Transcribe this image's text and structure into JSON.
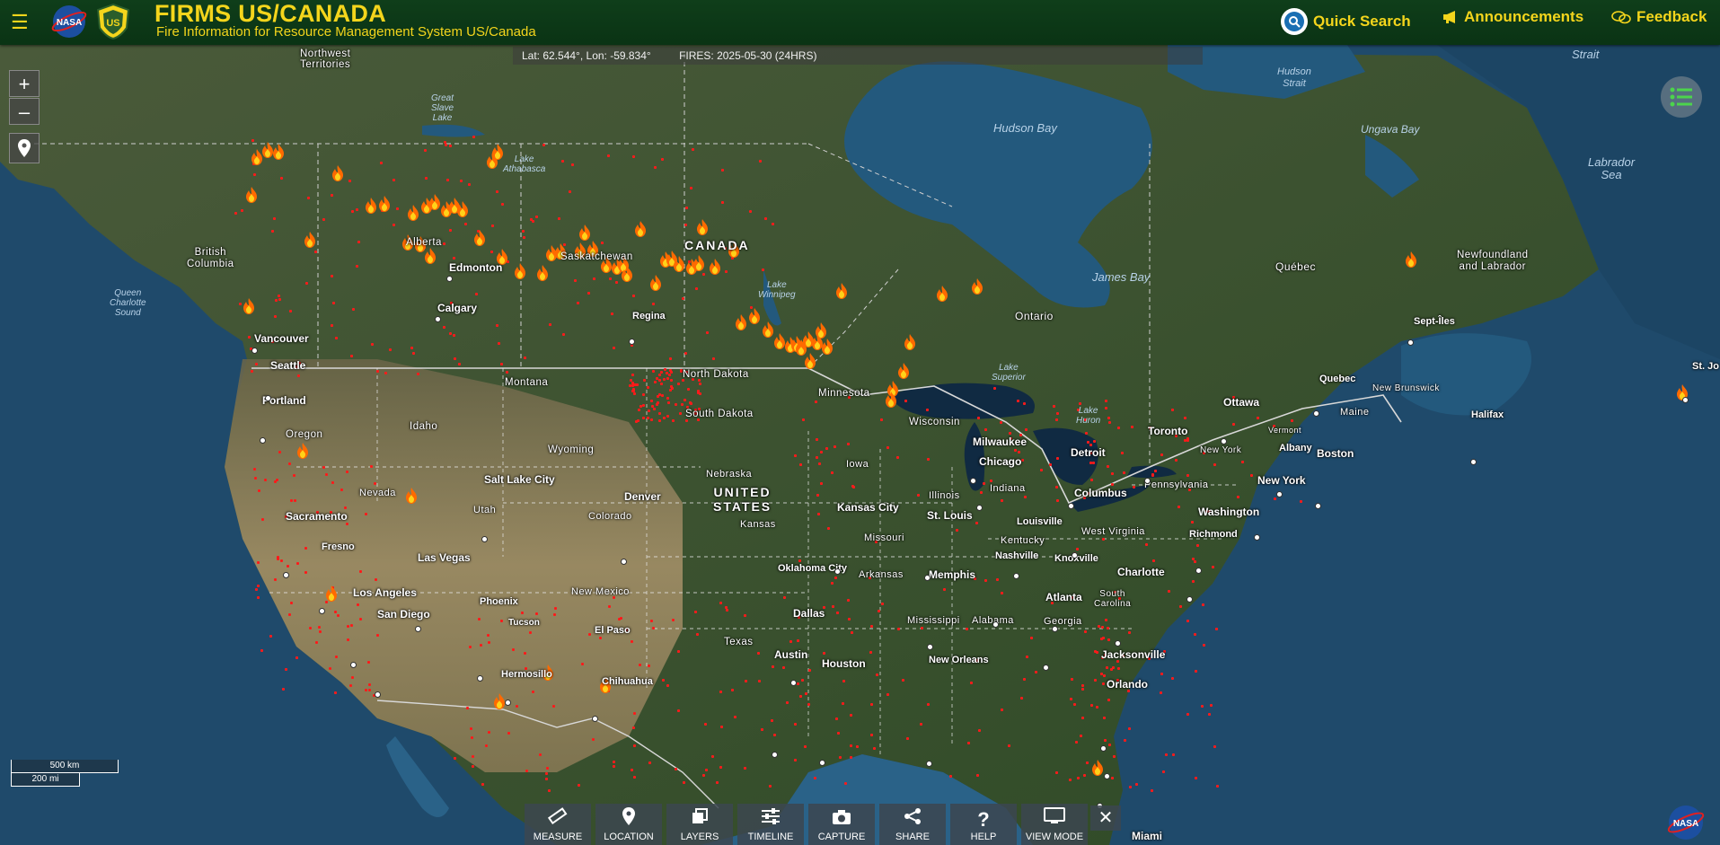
{
  "header": {
    "menu_icon": "hamburger-icon",
    "title": "FIRMS US/CANADA",
    "subtitle": "Fire Information for Resource Management System US/Canada",
    "quick_search": "Quick Search",
    "announcements": "Announcements",
    "feedback": "Feedback",
    "nasa_logo_text": "NASA",
    "usfs_logo_text": "US",
    "colors": {
      "accent": "#f4d51c",
      "bar": "#0f3e1a"
    }
  },
  "coord_bar": {
    "latlon": "Lat: 62.544°, Lon: -59.834°",
    "fires": "FIRES: 2025-05-30 (24HRS)"
  },
  "map_controls": {
    "zoom_in": "+",
    "zoom_out": "–"
  },
  "scale": {
    "km": "500 km",
    "mi": "200 mi"
  },
  "toolbar": {
    "measure": "MEASURE",
    "location": "LOCATION",
    "layers": "LAYERS",
    "timeline": "TIMELINE",
    "capture": "CAPTURE",
    "share": "SHARE",
    "help": "HELP",
    "view_mode": "VIEW MODE",
    "close": "✕"
  },
  "map_labels": {
    "northwest_territories_1": "Northwest",
    "northwest_territories_2": "Territories",
    "great_slave_lake_1": "Great",
    "great_slave_lake_2": "Slave",
    "great_slave_lake_3": "Lake",
    "lake_athabasca_1": "Lake",
    "lake_athabasca_2": "Athabasca",
    "hudson_bay": "Hudson Bay",
    "hudson_strait_1": "Hudson",
    "hudson_strait_2": "Strait",
    "ungava_bay": "Ungava Bay",
    "labrador_sea_1": "Labrador",
    "labrador_sea_2": "Sea",
    "strait": "Strait",
    "british_columbia_1": "British",
    "british_columbia_2": "Columbia",
    "alberta": "Alberta",
    "saskatchewan": "Saskatchewan",
    "canada": "CANADA",
    "edmonton": "Edmonton",
    "calgary": "Calgary",
    "regina": "Regina",
    "lake_winnipeg_1": "Lake",
    "lake_winnipeg_2": "Winnipeg",
    "james_bay": "James Bay",
    "ontario": "Ontario",
    "quebec_prov": "Québec",
    "newfoundland_1": "Newfoundland",
    "newfoundland_2": "and Labrador",
    "sept_iles": "Sept-Îles",
    "queen_charlotte_1": "Queen",
    "queen_charlotte_2": "Charlotte",
    "queen_charlotte_3": "Sound",
    "vancouver": "Vancouver",
    "seattle": "Seattle",
    "portland": "Portland",
    "oregon": "Oregon",
    "idaho": "Idaho",
    "montana": "Montana",
    "wyoming": "Wyoming",
    "north_dakota": "North Dakota",
    "south_dakota": "South Dakota",
    "minnesota": "Minnesota",
    "lake_superior_1": "Lake",
    "lake_superior_2": "Superior",
    "lake_huron_1": "Lake",
    "lake_huron_2": "Huron",
    "wisconsin": "Wisconsin",
    "milwaukee": "Milwaukee",
    "chicago": "Chicago",
    "detroit": "Detroit",
    "toronto": "Toronto",
    "ottawa": "Ottawa",
    "quebec_city": "Quebec",
    "new_brunswick": "New Brunswick",
    "maine": "Maine",
    "halifax": "Halifax",
    "vermont": "Vermont",
    "albany": "Albany",
    "boston": "Boston",
    "new_york_state": "New York",
    "new_york_city": "New York",
    "pennsylvania": "Pennsylvania",
    "washington": "Washington",
    "richmond": "Richmond",
    "west_virginia": "West Virginia",
    "columbus": "Columbus",
    "indiana": "Indiana",
    "illinois": "Illinois",
    "iowa": "Iowa",
    "nebraska": "Nebraska",
    "united_states_1": "UNITED",
    "united_states_2": "STATES",
    "denver": "Denver",
    "colorado": "Colorado",
    "utah": "Utah",
    "salt_lake_city": "Salt Lake City",
    "nevada": "Nevada",
    "sacramento": "Sacramento",
    "fresno": "Fresno",
    "las_vegas": "Las Vegas",
    "los_angeles": "Los Angeles",
    "san_diego": "San Diego",
    "phoenix": "Phoenix",
    "tucson": "Tucson",
    "new_mexico": "New Mexico",
    "el_paso": "El Paso",
    "kansas": "Kansas",
    "kansas_city": "Kansas City",
    "missouri": "Missouri",
    "st_louis": "St. Louis",
    "louisville": "Louisville",
    "kentucky": "Kentucky",
    "nashville": "Nashville",
    "knoxville": "Knoxville",
    "charlotte": "Charlotte",
    "south_carolina_1": "South",
    "south_carolina_2": "Carolina",
    "atlanta": "Atlanta",
    "georgia": "Georgia",
    "memphis": "Memphis",
    "arkansas": "Arkansas",
    "oklahoma_city": "Oklahoma City",
    "dallas": "Dallas",
    "texas": "Texas",
    "austin": "Austin",
    "houston": "Houston",
    "new_orleans": "New Orleans",
    "mississippi": "Mississippi",
    "alabama": "Alabama",
    "jacksonville": "Jacksonville",
    "orlando": "Orlando",
    "miami": "Miami",
    "hermosillo": "Hermosillo",
    "chihuahua": "Chihuahua",
    "st_johns": "St. Jo"
  }
}
